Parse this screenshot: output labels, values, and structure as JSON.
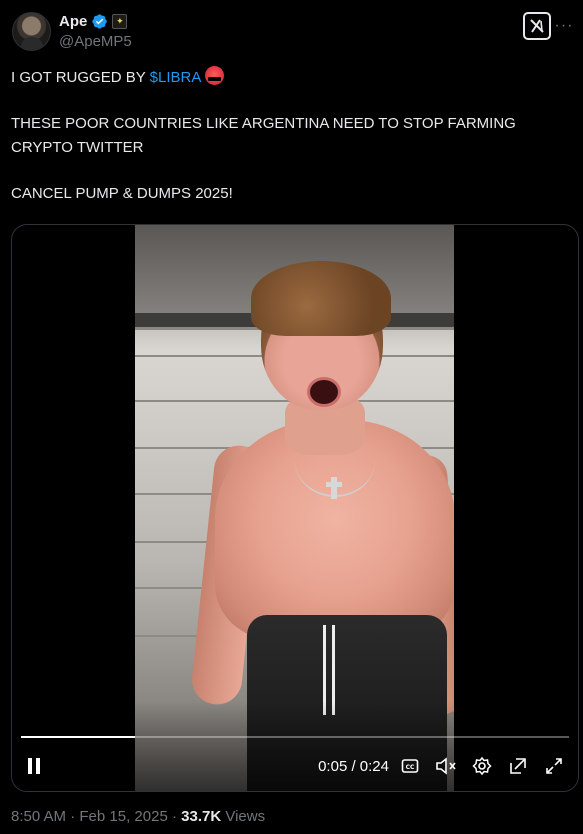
{
  "author": {
    "display_name": "Ape",
    "handle": "@ApeMP5",
    "verified": true,
    "verified_color": "#1d9bf0"
  },
  "tweet": {
    "line1_prefix": "I GOT RUGGED BY ",
    "cashtag": "$LIBRA",
    "line1_emoji": "angry-face-emoji",
    "paragraph2": "THESE POOR COUNTRIES LIKE ARGENTINA NEED TO STOP FARMING CRYPTO TWITTER",
    "paragraph3": "CANCEL PUMP & DUMPS 2025!"
  },
  "video": {
    "current_time": "0:05",
    "duration": "0:24",
    "time_display": "0:05 / 0:24",
    "progress_fraction": 0.208,
    "state": "playing",
    "muted": true,
    "controls": [
      "pause-icon",
      "captions-icon",
      "mute-icon",
      "settings-icon",
      "pop-out-icon",
      "fullscreen-icon"
    ]
  },
  "meta": {
    "time": "8:50 AM",
    "separator": " · ",
    "date": "Feb 15, 2025",
    "views_count": "33.7K",
    "views_label": " Views"
  },
  "colors": {
    "background": "#000000",
    "text": "#e7e9ea",
    "secondary": "#71767b",
    "link": "#1d9bf0",
    "border": "#2f3336"
  }
}
